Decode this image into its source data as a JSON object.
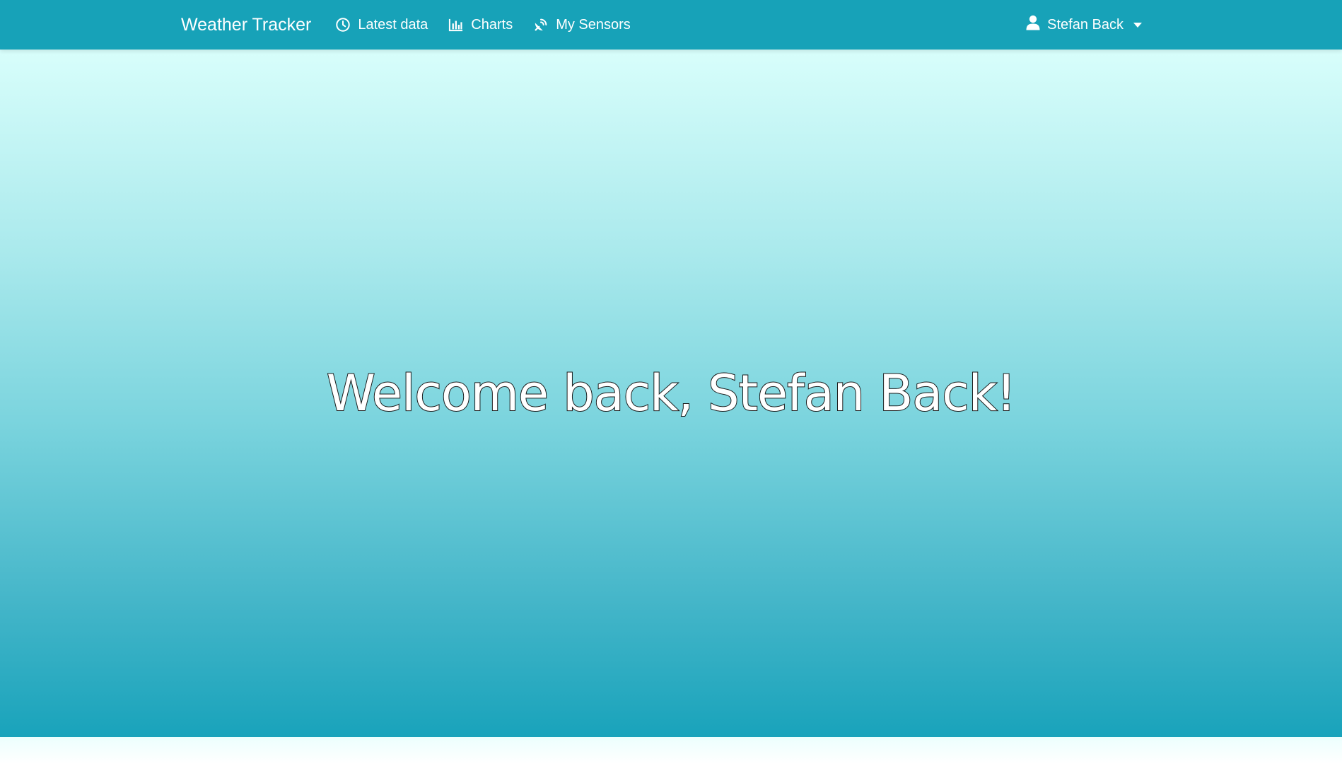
{
  "navbar": {
    "brand": "Weather Tracker",
    "links": [
      {
        "label": "Latest data",
        "icon": "clock-icon"
      },
      {
        "label": "Charts",
        "icon": "bar-chart-icon"
      },
      {
        "label": "My Sensors",
        "icon": "satellite-dish-icon"
      }
    ],
    "user": {
      "name": "Stefan Back",
      "icon": "user-icon"
    }
  },
  "hero": {
    "title": "Welcome back, Stefan Back!"
  },
  "colors": {
    "navbar": "#17a2b8",
    "gradient_top": "#d8fefb",
    "gradient_bottom": "#19a3bb"
  }
}
